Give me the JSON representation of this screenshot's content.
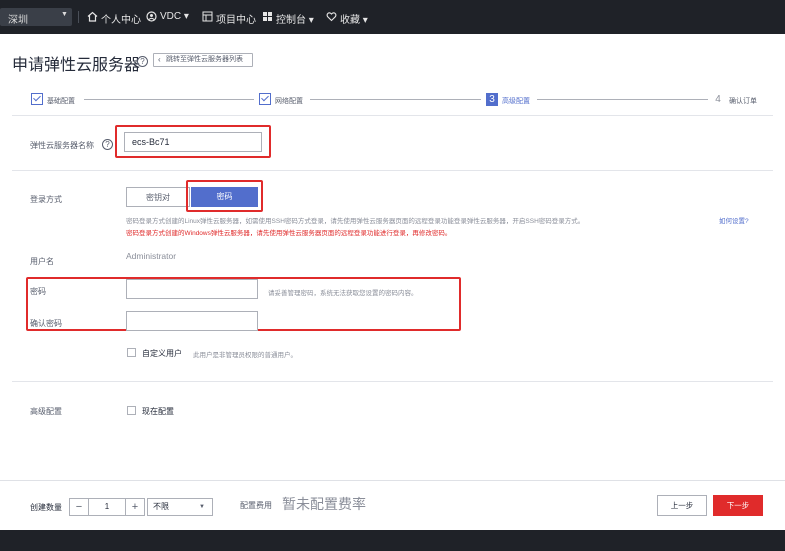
{
  "topnav": {
    "region": "深圳",
    "items": [
      "个人中心",
      "VDC ▾",
      "项目中心",
      "控制台 ▾",
      "收藏 ▾"
    ],
    "icons": [
      "home-icon",
      "vdc-icon",
      "project-icon",
      "console-icon",
      "heart-icon"
    ]
  },
  "header": {
    "title": "申请弹性云服务器",
    "help": "?",
    "back_link": "跳转至弹性云服务器列表"
  },
  "steps": [
    {
      "label": "基础配置",
      "state": "done"
    },
    {
      "label": "网络配置",
      "state": "done"
    },
    {
      "number": "3",
      "label": "高级配置",
      "state": "active"
    },
    {
      "number": "4",
      "label": "确认订单",
      "state": "pending"
    }
  ],
  "form": {
    "server_name_label": "弹性云服务器名称",
    "server_name_value": "ecs-Bc71",
    "login_method_label": "登录方式",
    "login_options": [
      "密钥对",
      "密码"
    ],
    "login_selected": "密码",
    "note_grey": "密码登录方式创建的Linux弹性云服务器，如需使用SSH密码方式登录，请先使用弹性云服务器页面的远程登录功能登录弹性云服务器，开启SSH密码登录方式。",
    "note_link": "如何设置?",
    "note_red": "密码登录方式创建的Windows弹性云服务器，请先使用弹性云服务器页面的远程登录功能进行登录，再修改密码。",
    "username_label": "用户名",
    "username_value": "Administrator",
    "password_label": "密码",
    "password_value": "",
    "password_hint": "请妥善管理密码，系统无法获取您设置的密码内容。",
    "confirm_label": "确认密码",
    "confirm_value": "",
    "custom_user_label": "自定义用户",
    "custom_user_hint": "此用户是非管理员权限的普通用户。",
    "advanced_label": "高级配置",
    "advanced_option": "现在配置"
  },
  "bottombar": {
    "quantity_label": "创建数量",
    "minus": "−",
    "quantity": "1",
    "plus": "+",
    "select_value": "不限",
    "fee_label": "配置费用",
    "fee_value": "暂未配置费率",
    "prev": "上一步",
    "next": "下一步"
  },
  "colors": {
    "accent": "#526ecc",
    "danger": "#e02b2b",
    "nav_bg": "#1f2228"
  }
}
